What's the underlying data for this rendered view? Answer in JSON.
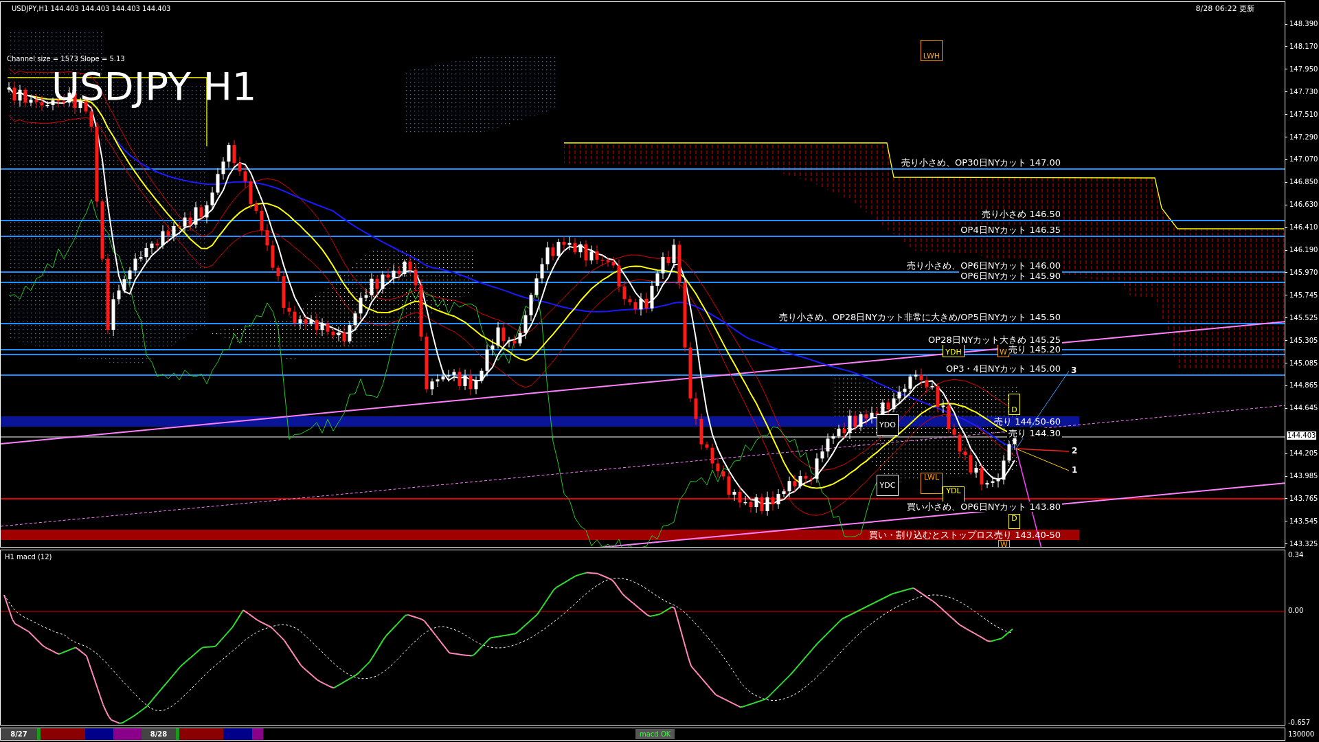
{
  "chart": {
    "symbol_line": "USDJPY,H1  144.403 144.403 144.403 144.403",
    "updated": "8/28 06:22 更新",
    "channel_info": "Channel size = 1573 Slope = 5.13",
    "big_title": "USDJPY H1",
    "levels": [
      {
        "kind": "line",
        "label": "売り小さめ、OP30日NYカット 147.00",
        "color": "#1e90ff"
      },
      {
        "kind": "line",
        "label": "売り小さめ 146.50",
        "color": "#1e90ff"
      },
      {
        "kind": "line",
        "label": "OP4日NYカット 146.35",
        "color": "#1e90ff"
      },
      {
        "kind": "line",
        "label": "売り小さめ、OP6日NYカット 146.00",
        "color": "#1e90ff"
      },
      {
        "kind": "line",
        "label": "OP6日NYカット 145.90",
        "color": "#1e90ff"
      },
      {
        "kind": "line",
        "label": "売り小さめ、OP28日NYカット非常に大きめ/OP5日NYカット 145.50",
        "color": "#1e90ff"
      },
      {
        "kind": "line",
        "label": "OP28日NYカット大きめ 145.25",
        "color": "#1e90ff"
      },
      {
        "kind": "line",
        "label": "売り 145.20",
        "color": "#1e90ff"
      },
      {
        "kind": "line",
        "label": "OP3・4日NYカット 145.00",
        "color": "#1e90ff"
      },
      {
        "kind": "band",
        "label": "売り 144.50-60",
        "color": "#0a1496"
      },
      {
        "kind": "line",
        "label": "売り 144.30",
        "color": "#808080"
      },
      {
        "kind": "line",
        "label": "買い小さめ、OP6日NYカット 143.80",
        "color": "#e00000"
      },
      {
        "kind": "band",
        "label": "買い・割り込むとストップロス売り 143.40-50",
        "color": "#a00000"
      }
    ],
    "markers": [
      {
        "label": "LWH",
        "color": "#ffa500"
      },
      {
        "label": "YDH",
        "color": "#ffff00"
      },
      {
        "label": "W",
        "color": "#ffa500"
      },
      {
        "label": "YDO",
        "color": "#ffffff"
      },
      {
        "label": "YDC",
        "color": "#ffffff"
      },
      {
        "label": "LWL",
        "color": "#ffa500"
      },
      {
        "label": "YDL",
        "color": "#ffff00"
      },
      {
        "label": "D",
        "color": "#ffff00"
      },
      {
        "label": "D",
        "color": "#ffff00"
      },
      {
        "label": "W",
        "color": "#ffa500"
      }
    ],
    "trend_numbers": [
      "3",
      "2",
      "1"
    ],
    "price_axis": [
      "148.390",
      "148.170",
      "147.950",
      "147.730",
      "147.510",
      "147.290",
      "147.070",
      "146.850",
      "146.630",
      "146.410",
      "146.190",
      "145.970",
      "145.745",
      "145.525",
      "145.305",
      "145.085",
      "144.865",
      "144.645",
      "144.205",
      "143.985",
      "143.765",
      "143.545",
      "143.325"
    ],
    "current_price": "144.403"
  },
  "macd": {
    "title": "H1  macd (12)",
    "axis": [
      "0.34",
      "0.00",
      "-0.657"
    ]
  },
  "bottom_bar": {
    "dates": [
      "8/27",
      "8/28"
    ],
    "status": "macd OK",
    "volume_scale": "130000"
  }
}
